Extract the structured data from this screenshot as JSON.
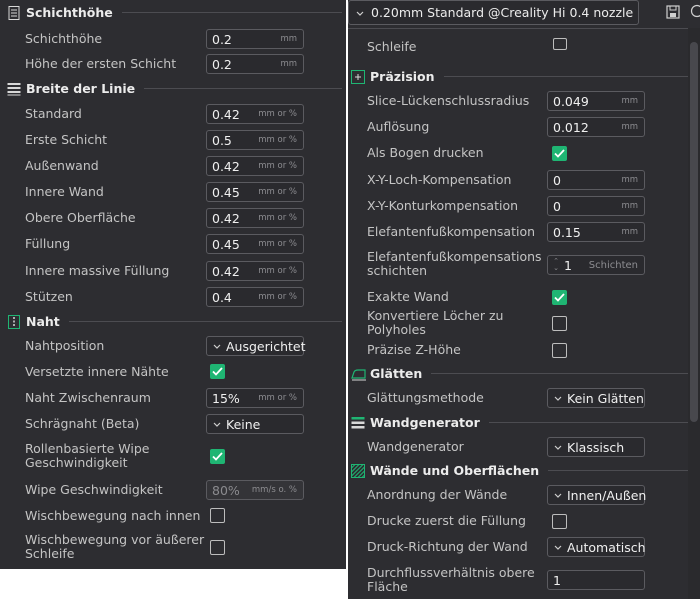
{
  "left": {
    "sections": {
      "layer_height": "Schichthöhe",
      "line_width": "Breite der Linie",
      "seam": "Naht"
    },
    "layer_height": {
      "layer_height": {
        "label": "Schichthöhe",
        "value": "0.2",
        "unit": "mm"
      },
      "first_layer_height": {
        "label": "Höhe der ersten Schicht",
        "value": "0.2",
        "unit": "mm"
      }
    },
    "line_width": {
      "default": {
        "label": "Standard",
        "value": "0.42",
        "unit": "mm or %"
      },
      "first_layer": {
        "label": "Erste Schicht",
        "value": "0.5",
        "unit": "mm or %"
      },
      "outer_wall": {
        "label": "Außenwand",
        "value": "0.42",
        "unit": "mm or %"
      },
      "inner_wall": {
        "label": "Innere Wand",
        "value": "0.45",
        "unit": "mm or %"
      },
      "top_surface": {
        "label": "Obere Oberfläche",
        "value": "0.42",
        "unit": "mm or %"
      },
      "infill": {
        "label": "Füllung",
        "value": "0.45",
        "unit": "mm or %"
      },
      "solid_infill": {
        "label": "Innere massive Füllung",
        "value": "0.42",
        "unit": "mm or %"
      },
      "support": {
        "label": "Stützen",
        "value": "0.4",
        "unit": "mm or %"
      }
    },
    "seam": {
      "position": {
        "label": "Nahtposition",
        "value": "Ausgerichtet"
      },
      "staggered": {
        "label": "Versetzte innere Nähte",
        "checked": true
      },
      "gap": {
        "label": "Naht Zwischenraum",
        "value": "15%",
        "unit": "mm or %"
      },
      "scarf": {
        "label": "Schrägnaht (Beta)",
        "value": "Keine"
      },
      "role_wipe": {
        "label": "Rollenbasierte Wipe Geschwindigkeit",
        "checked": true
      },
      "wipe_speed": {
        "label": "Wipe Geschwindigkeit",
        "value": "80%",
        "unit": "mm/s o. %"
      },
      "wipe_inward": {
        "label": "Wischbewegung nach innen",
        "checked": false
      },
      "wipe_before_outer": {
        "label": "Wischbewegung vor äußerer Schleife",
        "checked": false
      }
    }
  },
  "right": {
    "preset": {
      "label": "0.20mm Standard @Creality Hi 0.4 nozzle"
    },
    "partial_row": {
      "label": "Schleife",
      "checked": false
    },
    "sections": {
      "precision": "Präzision",
      "ironing": "Glätten",
      "wall_generator": "Wandgenerator",
      "walls_surfaces": "Wände und Oberflächen"
    },
    "precision": {
      "slice_gap": {
        "label": "Slice-Lückenschlussradius",
        "value": "0.049",
        "unit": "mm"
      },
      "resolution": {
        "label": "Auflösung",
        "value": "0.012",
        "unit": "mm"
      },
      "arc_fitting": {
        "label": "Als Bogen drucken",
        "checked": true
      },
      "xy_hole": {
        "label": "X-Y-Loch-Kompensation",
        "value": "0",
        "unit": "mm"
      },
      "xy_contour": {
        "label": "X-Y-Konturkompensation",
        "value": "0",
        "unit": "mm"
      },
      "elephant_foot": {
        "label": "Elefantenfußkompensation",
        "value": "0.15",
        "unit": "mm"
      },
      "elephant_layers": {
        "label": "Elefantenfußkompensations schichten",
        "value": "1",
        "unit": "Schichten"
      },
      "precise_wall": {
        "label": "Exakte Wand",
        "checked": true
      },
      "polyholes": {
        "label": "Konvertiere Löcher zu Polyholes",
        "checked": false
      },
      "precise_z": {
        "label": "Präzise Z-Höhe",
        "checked": false
      }
    },
    "ironing": {
      "method": {
        "label": "Glättungsmethode",
        "value": "Kein Glätten"
      }
    },
    "wall_generator": {
      "generator": {
        "label": "Wandgenerator",
        "value": "Klassisch"
      }
    },
    "walls_surfaces": {
      "order": {
        "label": "Anordnung der Wände",
        "value": "Innen/Außen"
      },
      "infill_first": {
        "label": "Drucke zuerst die Füllung",
        "checked": false
      },
      "wall_direction": {
        "label": "Druck-Richtung der Wand",
        "value": "Automatisch"
      },
      "top_flow": {
        "label": "Durchflussverhältnis obere Fläche",
        "value": "1"
      }
    }
  },
  "colors": {
    "panel": "#2d2d31",
    "accent": "#1fb573",
    "field_border": "#5b5b60"
  }
}
